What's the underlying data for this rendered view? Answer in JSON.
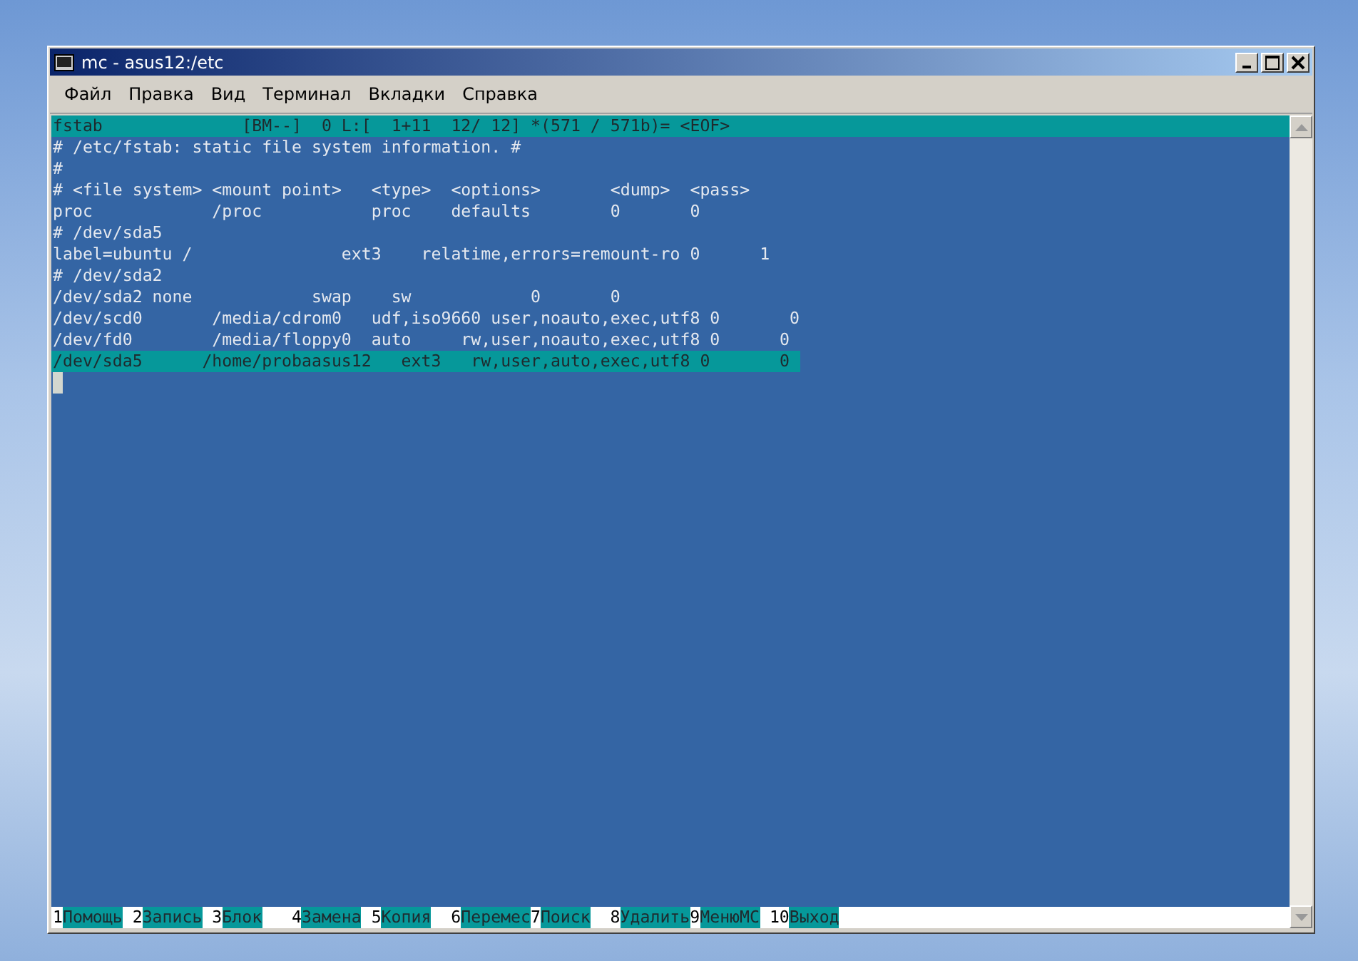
{
  "window": {
    "title": "mc - asus12:/etc"
  },
  "menu": [
    "Файл",
    "Правка",
    "Вид",
    "Терминал",
    "Вкладки",
    "Справка"
  ],
  "editor": {
    "status": "fstab              [BM--]  0 L:[  1+11  12/ 12] *(571 / 571b)= <EOF>",
    "lines": [
      {
        "text": "# /etc/fstab: static file system information. #",
        "selected": false
      },
      {
        "text": "#",
        "selected": false
      },
      {
        "text": "# <file system> <mount point>   <type>  <options>       <dump>  <pass>",
        "selected": false
      },
      {
        "text": "proc            /proc           proc    defaults        0       0",
        "selected": false
      },
      {
        "text": "# /dev/sda5",
        "selected": false
      },
      {
        "text": "label=ubuntu /               ext3    relatime,errors=remount-ro 0      1",
        "selected": false
      },
      {
        "text": "# /dev/sda2",
        "selected": false
      },
      {
        "text": "/dev/sda2 none            swap    sw            0       0",
        "selected": false
      },
      {
        "text": "/dev/scd0       /media/cdrom0   udf,iso9660 user,noauto,exec,utf8 0       0",
        "selected": false
      },
      {
        "text": "/dev/fd0        /media/floppy0  auto     rw,user,noauto,exec,utf8 0      0",
        "selected": false
      },
      {
        "text": "/dev/sda5      /home/probaasus12   ext3   rw,user,auto,exec,utf8 0       0 ",
        "selected": true
      }
    ],
    "cursor_visible": true
  },
  "function_keys": [
    {
      "number": "1",
      "label": "Помощь"
    },
    {
      "number": "2",
      "label": "Запись"
    },
    {
      "number": "3",
      "label": "Блок"
    },
    {
      "number": "4",
      "label": "Замена"
    },
    {
      "number": "5",
      "label": "Копия"
    },
    {
      "number": "6",
      "label": "Перемес"
    },
    {
      "number": "7",
      "label": "Поиск"
    },
    {
      "number": "8",
      "label": "Удалить"
    },
    {
      "number": "9",
      "label": "МенюMC"
    },
    {
      "number": "10",
      "label": "Выход"
    }
  ]
}
